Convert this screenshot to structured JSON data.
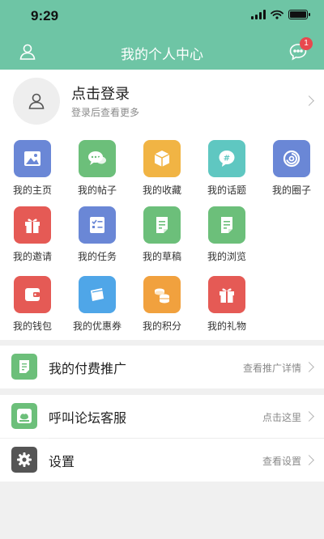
{
  "status_bar": {
    "time": "9:29"
  },
  "nav": {
    "title": "我的个人中心",
    "badge_count": "1"
  },
  "login": {
    "title": "点击登录",
    "subtitle": "登录后查看更多"
  },
  "grid": [
    {
      "label": "我的主页",
      "icon": "picture-icon",
      "color": "#6a87d6"
    },
    {
      "label": "我的帖子",
      "icon": "chat-bubbles-icon",
      "color": "#6cbf7a"
    },
    {
      "label": "我的收藏",
      "icon": "box-icon",
      "color": "#f1b444"
    },
    {
      "label": "我的话题",
      "icon": "hashtag-icon",
      "color": "#5fc7c1"
    },
    {
      "label": "我的圈子",
      "icon": "circle-icon",
      "color": "#6a87d6"
    },
    {
      "label": "我的邀请",
      "icon": "gift-icon",
      "color": "#e55a55"
    },
    {
      "label": "我的任务",
      "icon": "checklist-icon",
      "color": "#6a87d6"
    },
    {
      "label": "我的草稿",
      "icon": "draft-icon",
      "color": "#6cbf7a"
    },
    {
      "label": "我的浏览",
      "icon": "document-icon",
      "color": "#6cbf7a"
    },
    {
      "label": "我的钱包",
      "icon": "wallet-icon",
      "color": "#e55a55"
    },
    {
      "label": "我的优惠券",
      "icon": "coupon-icon",
      "color": "#4fa6e8"
    },
    {
      "label": "我的积分",
      "icon": "coins-icon",
      "color": "#f1a13e"
    },
    {
      "label": "我的礼物",
      "icon": "gift-icon",
      "color": "#e55a55"
    }
  ],
  "rows": {
    "promotion": {
      "label": "我的付费推广",
      "right": "查看推广详情",
      "icon": "promotion-icon",
      "color": "#6cbf7a"
    },
    "service": {
      "label": "呼叫论坛客服",
      "right": "点击这里",
      "icon": "service-icon",
      "color": "#6cbf7a"
    },
    "settings": {
      "label": "设置",
      "right": "查看设置",
      "icon": "gear-icon",
      "color": "#555555"
    }
  }
}
